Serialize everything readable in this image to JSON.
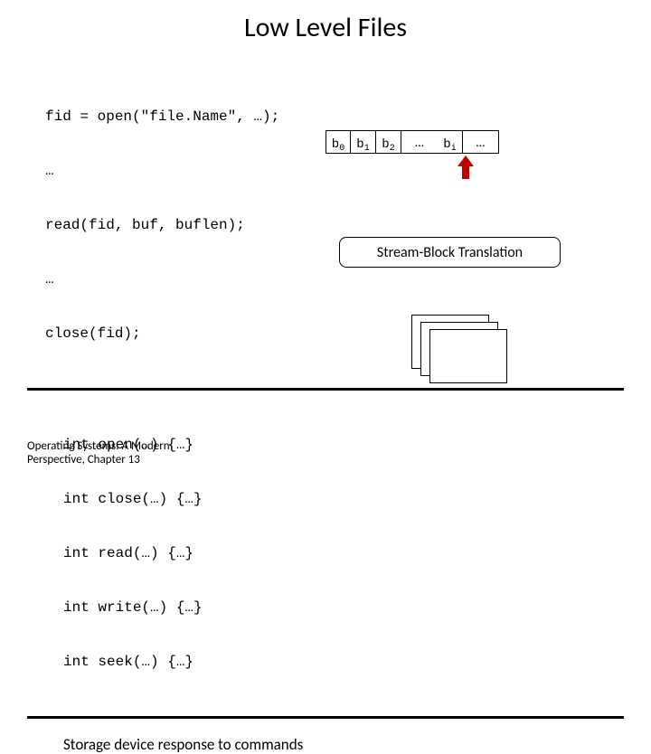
{
  "title": "Low Level Files",
  "section1": {
    "code_lines": [
      "fid = open(\"file.Name\", …);",
      "…",
      "read(fid, buf, buflen);",
      "…",
      "close(fid);"
    ]
  },
  "blocks": {
    "b0": "b",
    "b0_sub": "0",
    "b1": "b",
    "b1_sub": "1",
    "b2": "b",
    "b2_sub": "2",
    "dots1": "…",
    "bi": "b",
    "bi_sub": "i",
    "dots2": "…"
  },
  "section2": {
    "code_lines": [
      "int open(…) {…}",
      "int close(…) {…}",
      "int read(…) {…}",
      "int write(…) {…}",
      "int seek(…) {…}"
    ]
  },
  "stream_box": "Stream-Block Translation",
  "section3": {
    "label": "Storage device response to commands"
  },
  "footer": {
    "line1": "Operating Systems: A Modern",
    "line2": "Perspective, Chapter 13"
  }
}
